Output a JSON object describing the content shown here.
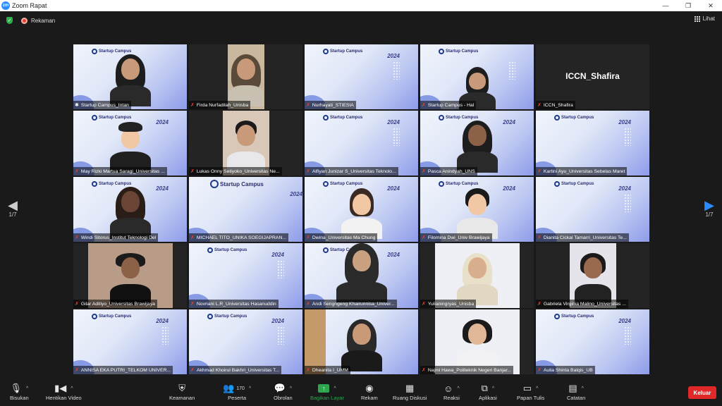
{
  "window": {
    "title": "Zoom Rapat",
    "controls": [
      "—",
      "❐",
      "✕"
    ]
  },
  "infobar": {
    "recording_label": "Rekaman",
    "view_label": "Lihat"
  },
  "pagination": {
    "left": "1/7",
    "right": "1/7"
  },
  "participants": [
    {
      "name": "Startup Campus_Intan",
      "muted": false
    },
    {
      "name": "Firda Nurfadilah_Unisba",
      "muted": true
    },
    {
      "name": "Nurhayati_STIESIA",
      "muted": true
    },
    {
      "name": "Startup Campus - Hal",
      "muted": true
    },
    {
      "name": "ICCN_Shafira",
      "muted": true,
      "display_text": "ICCN_Shafira"
    },
    {
      "name": "May Rizki Martua Saragi_Universitas ...",
      "muted": true
    },
    {
      "name": "Lukas Onny Setiyoko_Universitas Ne...",
      "muted": true
    },
    {
      "name": "Alfiyan Junizar S_Universitas Teknolo...",
      "muted": true
    },
    {
      "name": "Pasca Anindyah_UNS",
      "muted": true
    },
    {
      "name": "Kartini Ayu_Universitas Sebelas Maret",
      "muted": true
    },
    {
      "name": "Windi Sitorus_Institut Teknologi Del",
      "muted": true
    },
    {
      "name": "MICHAEL TITO_UNIKA SOEGIJAPRAN...",
      "muted": true
    },
    {
      "name": "Dwina_Universitas Ma Chung",
      "muted": true
    },
    {
      "name": "Filomina Dwi_Univ Brawijaya",
      "muted": true
    },
    {
      "name": "Dianita Cickal Tamarri_Universitas Te...",
      "muted": true
    },
    {
      "name": "Gilar Aditiyo_Universitas Brawijaya",
      "muted": true
    },
    {
      "name": "Novriani L.R_Universitas Hasanuddin",
      "muted": true
    },
    {
      "name": "Andi Sengngeng Khairunnisa_Univer...",
      "muted": true
    },
    {
      "name": "Yulianingryas_Unisba",
      "muted": true
    },
    {
      "name": "Gabriela Virginia Malino_Universitas ...",
      "muted": true
    },
    {
      "name": "ANNISA EKA PUTRI_TELKOM UNIVER...",
      "muted": true
    },
    {
      "name": "Akhmad Khoirul Bakhri_Universitas T...",
      "muted": true
    },
    {
      "name": "Dheanita I_UMM",
      "muted": true
    },
    {
      "name": "Najmi Hawa_Politeknik Negeri Banjar...",
      "muted": true
    },
    {
      "name": "Aulia Shinta Balqis_UB",
      "muted": true
    }
  ],
  "slide": {
    "brand": "Startup Campus",
    "year": "2024"
  },
  "toolbar": {
    "mute": "Bisukan",
    "stop_video": "Hentikan Video",
    "security": "Keamanan",
    "participants": "Peserta",
    "participants_count": "170",
    "chat": "Obrolan",
    "share": "Bagikan Layar",
    "record": "Rekam",
    "breakout": "Ruang Diskusi",
    "reactions": "Reaksi",
    "apps": "Aplikasi",
    "whiteboard": "Papan Tulis",
    "notes": "Catatan",
    "leave": "Keluar"
  },
  "colors": {
    "accent_blue": "#2d8cff",
    "active_speaker": "#c9e04a",
    "share_green": "#2ea650",
    "leave_red": "#e02828",
    "muted_red": "#e5412d"
  }
}
